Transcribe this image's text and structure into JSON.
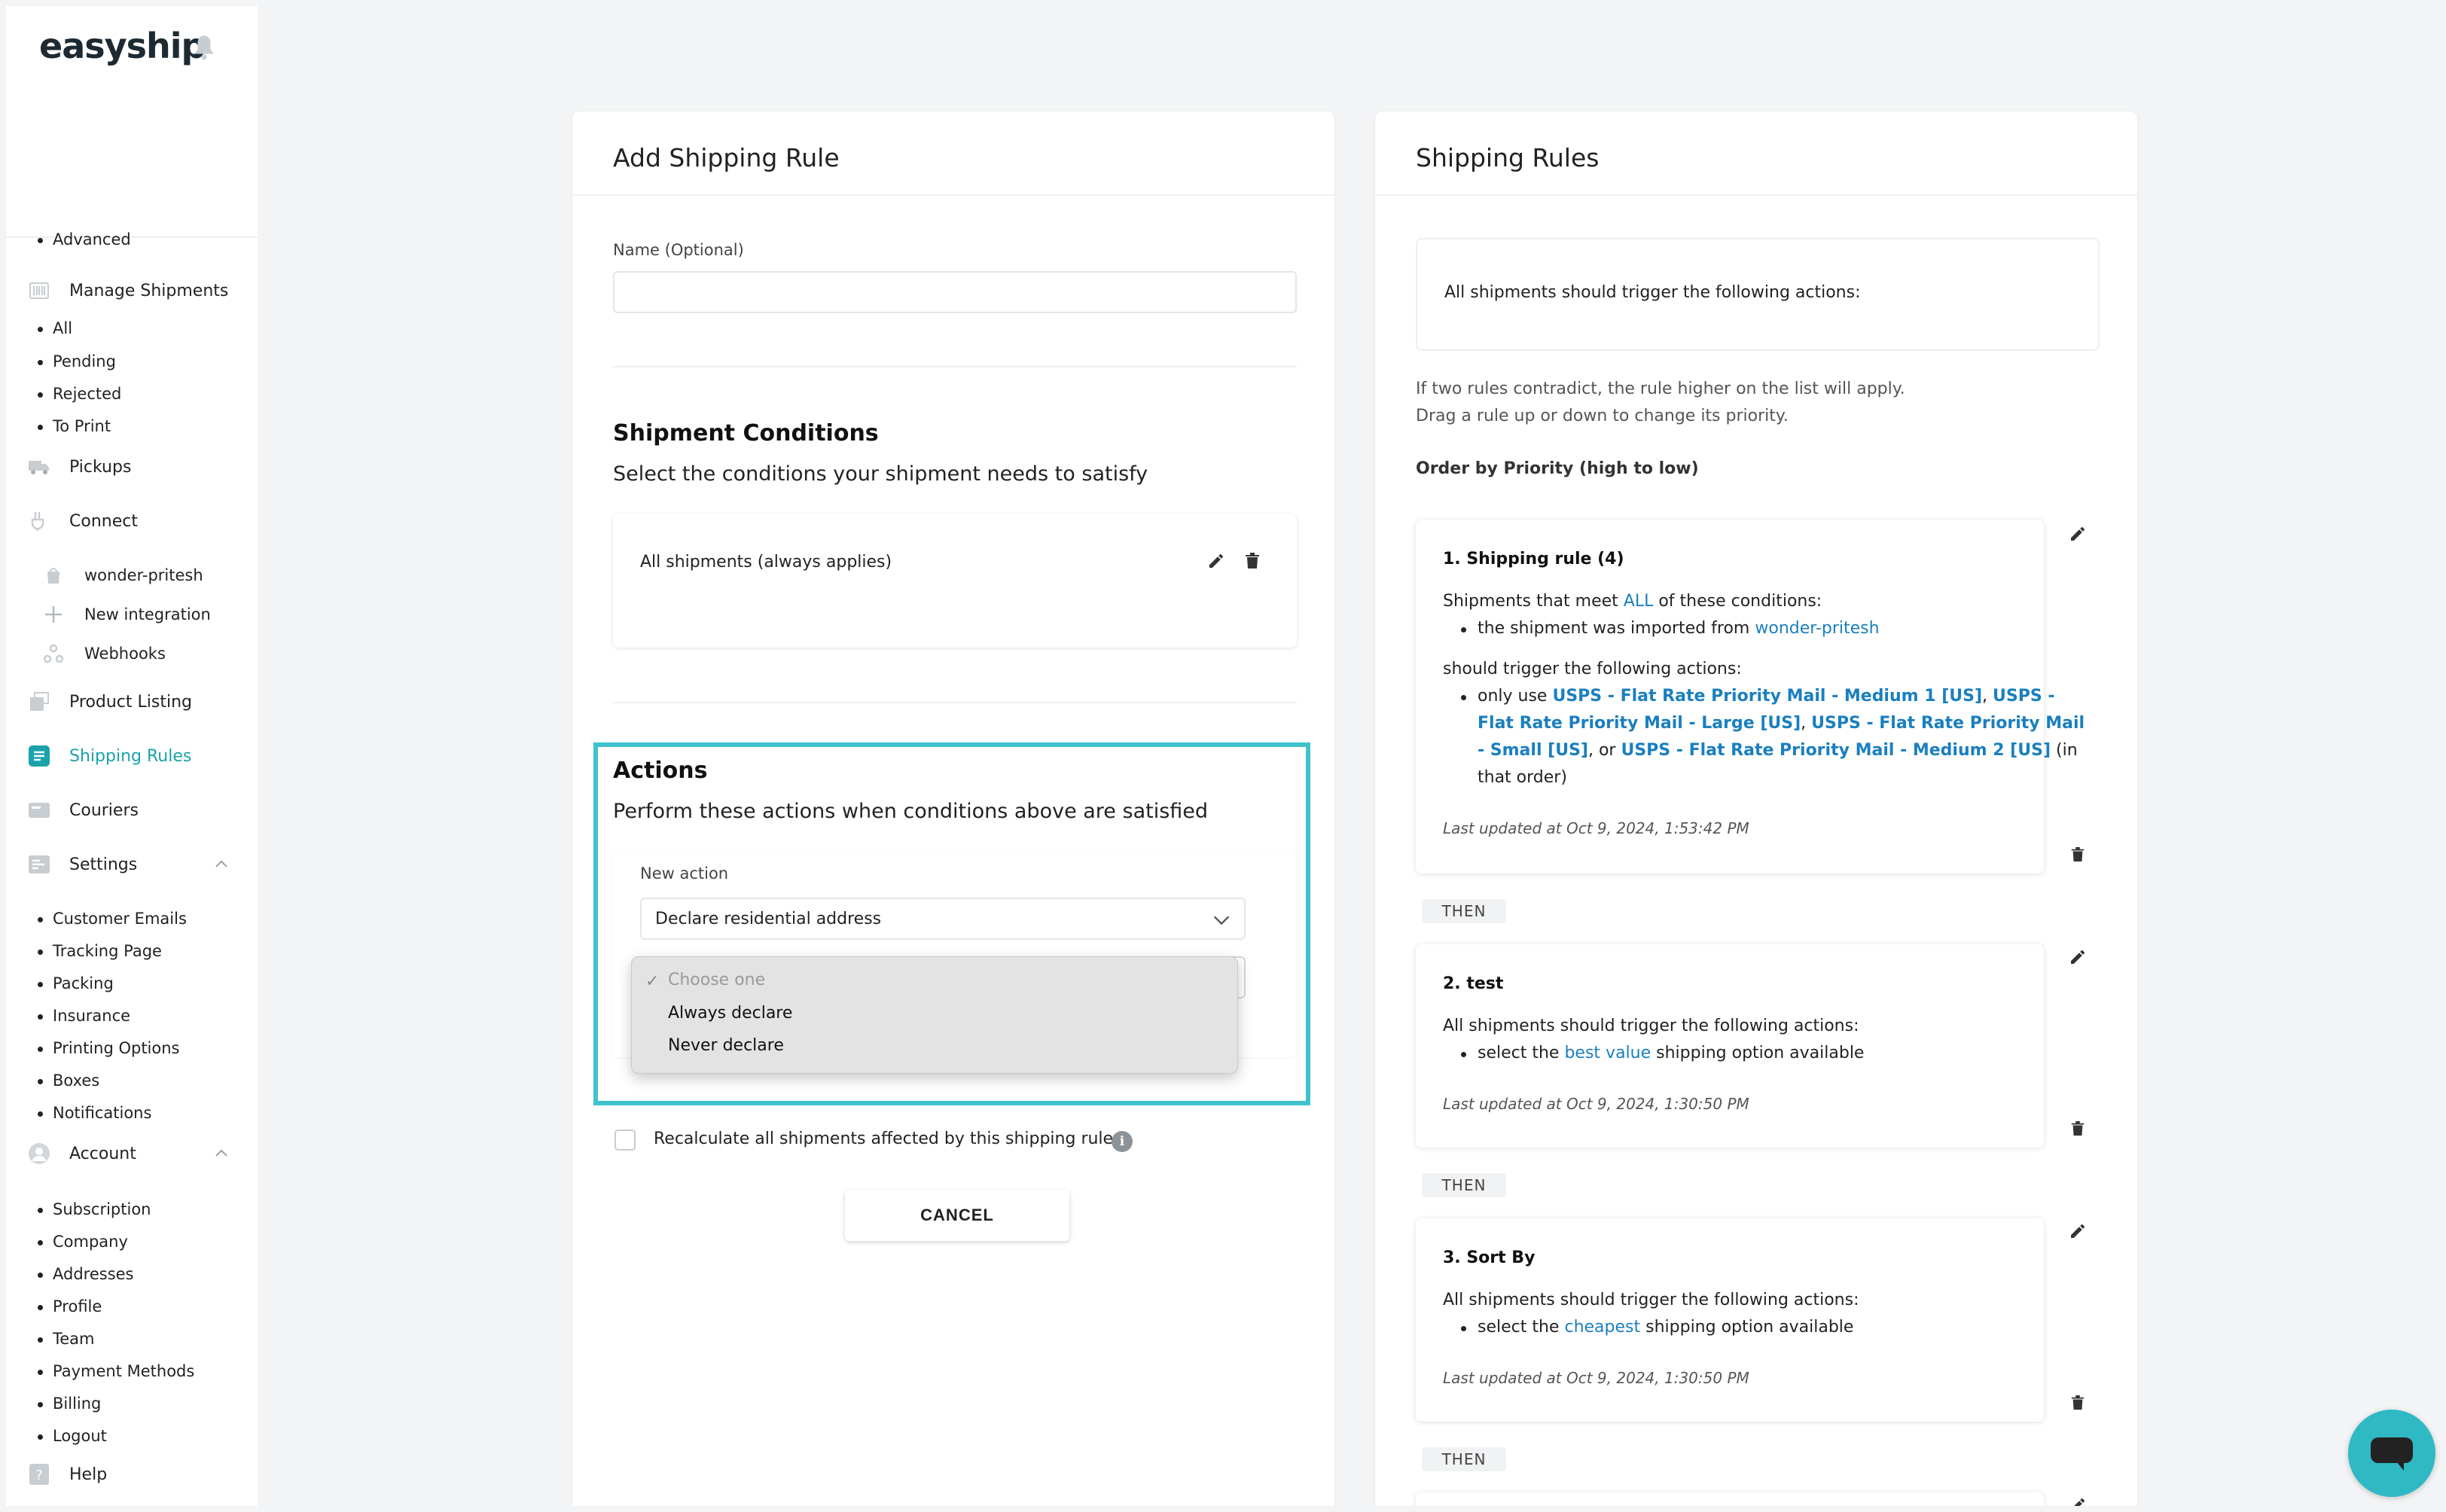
{
  "sidebar": {
    "logo": "easyship",
    "advanced": "Advanced",
    "manage_shipments": "Manage Shipments",
    "shipments_sub": [
      "All",
      "Pending",
      "Rejected",
      "To Print"
    ],
    "pickups": "Pickups",
    "connect": "Connect",
    "integrations": [
      "wonder-pritesh",
      "New integration",
      "Webhooks"
    ],
    "product_listing": "Product Listing",
    "shipping_rules": "Shipping Rules",
    "couriers": "Couriers",
    "settings": "Settings",
    "settings_sub": [
      "Customer Emails",
      "Tracking Page",
      "Packing",
      "Insurance",
      "Printing Options",
      "Boxes",
      "Notifications"
    ],
    "account": "Account",
    "account_sub": [
      "Subscription",
      "Company",
      "Addresses",
      "Profile",
      "Team",
      "Payment Methods",
      "Billing",
      "Logout"
    ],
    "help": "Help"
  },
  "add_rule": {
    "title": "Add Shipping Rule",
    "name_label": "Name (Optional)",
    "name_value": "",
    "conditions_heading": "Shipment Conditions",
    "conditions_sub": "Select the conditions your shipment needs to satisfy",
    "condition_text": "All shipments (always applies)",
    "actions_heading": "Actions",
    "actions_sub": "Perform these actions when conditions above are satisfied",
    "new_action_label": "New action",
    "new_action_value": "Declare residential address",
    "dropdown_options": [
      "Choose one",
      "Always declare",
      "Never declare"
    ],
    "recalc_label": "Recalculate all shipments affected by this shipping rule",
    "cancel": "CANCEL"
  },
  "rules_panel": {
    "title": "Shipping Rules",
    "all_shipments_text": "All shipments should trigger the following actions:",
    "note1": "If two rules contradict, the rule higher on the list will apply.",
    "note2": "Drag a rule up or down to change its priority.",
    "order_label": "Order by Priority (high to low)",
    "then": "THEN",
    "rule1": {
      "title": "1. Shipping rule (4)",
      "cond_pre": "Shipments that meet ",
      "cond_all": "ALL",
      "cond_post": " of these conditions:",
      "bullet_pre": "the shipment was imported from ",
      "bullet_link": "wonder-pritesh",
      "trigger": "should trigger the following actions:",
      "action_l1_pre": "only use ",
      "action_l1_link": "USPS - Flat Rate Priority Mail - Medium 1 [US]",
      "action_l1_sep": ", ",
      "action_l1_link2": "USPS -",
      "action_l2_link": "Flat Rate Priority Mail - Large [US]",
      "action_l2_sep": ", ",
      "action_l2_link2": "USPS - Flat Rate Priority Mail",
      "action_l3_link": "- Small [US]",
      "action_l3_sep": ", or ",
      "action_l3_link2": "USPS - Flat Rate Priority Mail - Medium 2 [US]",
      "action_l3_post": " (in",
      "action_l4": "that order)",
      "updated": "Last updated at Oct 9, 2024, 1:53:42 PM"
    },
    "rule2": {
      "title": "2. test",
      "line": "All shipments should trigger the following actions:",
      "bullet_pre": "select the ",
      "bullet_link": "best value",
      "bullet_post": " shipping option available",
      "updated": "Last updated at Oct 9, 2024, 1:30:50 PM"
    },
    "rule3": {
      "title": "3. Sort By",
      "line": "All shipments should trigger the following actions:",
      "bullet_pre": "select the ",
      "bullet_link": "cheapest",
      "bullet_post": " shipping option available",
      "updated": "Last updated at Oct 9, 2024, 1:30:50 PM"
    }
  },
  "colors": {
    "accent": "#3fc2cc",
    "link": "#1a7fbf",
    "active_nav": "#1aa3a9"
  }
}
